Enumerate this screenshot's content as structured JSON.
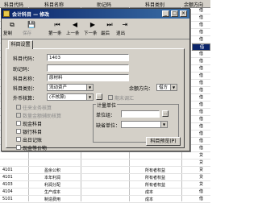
{
  "grid": {
    "headers": [
      "科目代码",
      "科目名称",
      "助记码",
      "科目类别",
      "余额方向"
    ],
    "top_rows": [
      {
        "dir": "借"
      },
      {
        "dir": "借"
      },
      {
        "dir": "借"
      },
      {
        "dir": "借"
      },
      {
        "dir": "借"
      },
      {
        "dir": "借",
        "selected": true
      },
      {
        "dir": "借"
      },
      {
        "dir": "借"
      },
      {
        "dir": "借"
      },
      {
        "dir": "借"
      },
      {
        "dir": "借"
      },
      {
        "dir": "借"
      },
      {
        "dir": "借"
      },
      {
        "dir": "借"
      },
      {
        "dir": "借"
      },
      {
        "dir": "借"
      },
      {
        "dir": "借"
      },
      {
        "dir": "借"
      },
      {
        "dir": "借"
      },
      {
        "dir": "借"
      },
      {
        "dir": "贷"
      },
      {
        "dir": "贷"
      }
    ],
    "bottom_rows": [
      {
        "code": "4101",
        "name": "盈余公积",
        "type": "所有者权益",
        "dir": "贷"
      },
      {
        "code": "4101",
        "name": "本年利润",
        "type": "所有者权益",
        "dir": "贷"
      },
      {
        "code": "4103",
        "name": "利润分配",
        "type": "所有者权益",
        "dir": "贷"
      },
      {
        "code": "4104",
        "name": "生产成本",
        "type": "成本",
        "dir": "借"
      },
      {
        "code": "5101",
        "name": "制造费用",
        "type": "成本",
        "dir": "借"
      }
    ]
  },
  "dialog": {
    "title": "会计科目 — 修改",
    "toolbar": [
      {
        "label": "复制",
        "icon": "⧉"
      },
      {
        "label": "保存",
        "icon": "💾",
        "disabled": true
      },
      {
        "label": "第一条",
        "icon": "⏮"
      },
      {
        "label": "上一条",
        "icon": "◀"
      },
      {
        "label": "下一条",
        "icon": "▶"
      },
      {
        "label": "最后",
        "icon": "⏭"
      },
      {
        "label": "退出",
        "icon": "⇥"
      }
    ],
    "tab": "科目设置",
    "fields": {
      "code_label": "科目代码：",
      "code_value": "1403",
      "mnemonic_label": "助记码：",
      "mnemonic_value": "",
      "name_label": "科目名称：",
      "name_value": "原材料",
      "type_label": "科目类别：",
      "type_value": "流动资产",
      "direction_label": "余额方向：",
      "direction_value": "借方",
      "fx_label": "外币核算：",
      "fx_value": "(不核算)",
      "fx_check_label": "期末调汇"
    },
    "checks": [
      {
        "label": "往来业务核算",
        "disabled": true
      },
      {
        "label": "数量金额辅助核算",
        "disabled": true
      },
      {
        "label": "现金科目",
        "disabled": false
      },
      {
        "label": "银行科目",
        "disabled": false
      },
      {
        "label": "出日记账",
        "disabled": false
      },
      {
        "label": "现金等价物",
        "disabled": false
      }
    ],
    "unit_group": {
      "title": "计量单位",
      "group_label": "单位组：",
      "unit_label": "缺省单位："
    },
    "preview_button": "科目预览(P)"
  },
  "colors": {
    "titlebar": "#0a246a",
    "dialog_face": "#d4d0c8",
    "selection": "#0a246a"
  }
}
